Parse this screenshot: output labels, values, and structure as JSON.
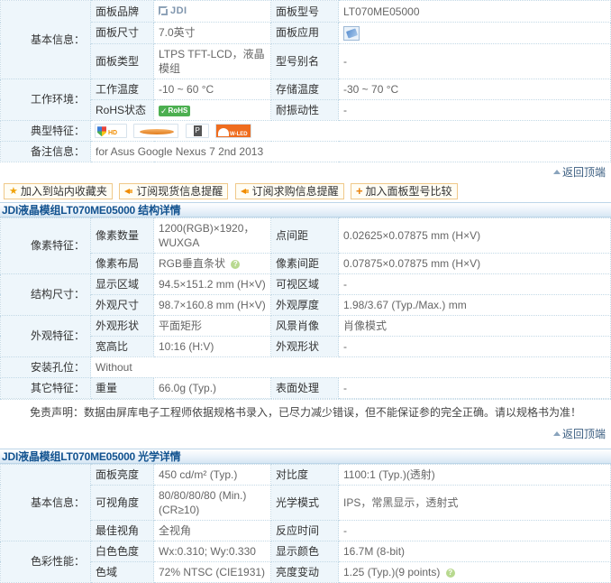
{
  "basic_section": {
    "rows": [
      {
        "group": "基本信息：",
        "group_rowspan": 3,
        "label": "面板品牌",
        "value_type": "jdi-logo",
        "value": "JDI",
        "label2": "面板型号",
        "value2": "LT070ME05000"
      },
      {
        "label": "面板尺寸",
        "value": "7.0英寸",
        "label2": "面板应用",
        "value2_type": "app-icon",
        "value2": ""
      },
      {
        "label": "面板类型",
        "value": "LTPS TFT-LCD，液晶模组",
        "label2": "型号别名",
        "value2": "-"
      },
      {
        "group": "工作环境：",
        "group_rowspan": 2,
        "label": "工作温度",
        "value": "-10 ~ 60 °C",
        "label2": "存储温度",
        "value2": "-30 ~ 70 °C"
      },
      {
        "label": "RoHS状态",
        "value_type": "rohs",
        "value": "RoHS",
        "label2": "耐振动性",
        "value2": "-"
      }
    ],
    "typical_label": "典型特征：",
    "typical_features": [
      "hd-badge-icon",
      "lens-badge-icon",
      "p-badge-icon",
      "wled-badge-icon"
    ],
    "remark_label": "备注信息：",
    "remark_value": "for Asus Google Nexus 7 2nd 2013"
  },
  "back_to_top": "返回顶端",
  "actions": [
    {
      "icon": "star-icon",
      "label": "加入到站内收藏夹"
    },
    {
      "icon": "speaker-icon",
      "label": "订阅现货信息提醒"
    },
    {
      "icon": "speaker-icon",
      "label": "订阅求购信息提醒"
    },
    {
      "icon": "plus-icon",
      "label": "加入面板型号比较"
    }
  ],
  "structure_section": {
    "title": "JDI液晶模组LT070ME05000 结构详情",
    "rows": [
      {
        "group": "像素特征：",
        "label": "像素数量",
        "value": "1200(RGB)×1920，WUXGA",
        "label2": "点间距",
        "value2": "0.02625×0.07875 mm (H×V)"
      },
      {
        "label": "像素布局",
        "value": "RGB垂直条状",
        "value_help": true,
        "label2": "像素间距",
        "value2": "0.07875×0.07875 mm (H×V)"
      },
      {
        "group": "结构尺寸：",
        "label": "显示区域",
        "value": "94.5×151.2 mm (H×V)",
        "label2": "可视区域",
        "value2": "-"
      },
      {
        "label": "外观尺寸",
        "value": "98.7×160.8 mm (H×V)",
        "label2": "外观厚度",
        "value2": "1.98/3.67 (Typ./Max.) mm"
      },
      {
        "group": "外观特征：",
        "label": "外观形状",
        "value": "平面矩形",
        "label2": "风景肖像",
        "value2": "肖像模式"
      },
      {
        "label": "宽高比",
        "value": "10:16 (H:V)",
        "label2": "外观形状",
        "value2": "-"
      }
    ],
    "mount_label": "安装孔位：",
    "mount_value": "Without",
    "other_label": "其它特征：",
    "other_rows": [
      {
        "label": "重量",
        "value": "66.0g (Typ.)",
        "label2": "表面处理",
        "value2": "-"
      }
    ],
    "disclaimer": "免责声明：数据由屏库电子工程师依据规格书录入，已尽力减少错误，但不能保证参的完全正确。请以规格书为准！"
  },
  "optical_section": {
    "title": "JDI液晶模组LT070ME05000 光学详情",
    "rows": [
      {
        "group": "基本信息：",
        "label": "面板亮度",
        "value": "450 cd/m² (Typ.)",
        "label2": "对比度",
        "value2": "1100:1 (Typ.)(透射)"
      },
      {
        "label": "可视角度",
        "value": "80/80/80/80 (Min.) (CR≥10)",
        "label2": "光学模式",
        "value2": "IPS，常黑显示，透射式"
      },
      {
        "label": "最佳视角",
        "value": "全视角",
        "label2": "反应时间",
        "value2": "-"
      },
      {
        "group": "色彩性能：",
        "label": "白色色度",
        "value": "Wx:0.310; Wy:0.330",
        "label2": "显示颜色",
        "value2": "16.7M (8-bit)"
      },
      {
        "label": "色域",
        "value": "72% NTSC (CIE1931)",
        "label2": "亮度变动",
        "value2": "1.25 (Typ.)(9 points)",
        "value2_help": true
      }
    ]
  },
  "colors": {
    "label_bg": "#eef6fb",
    "border": "#c3d9e6",
    "section_title": "#12528f",
    "link": "#3a5d80",
    "accent_orange": "#f0a30a",
    "rohs_green": "#4caf50"
  }
}
